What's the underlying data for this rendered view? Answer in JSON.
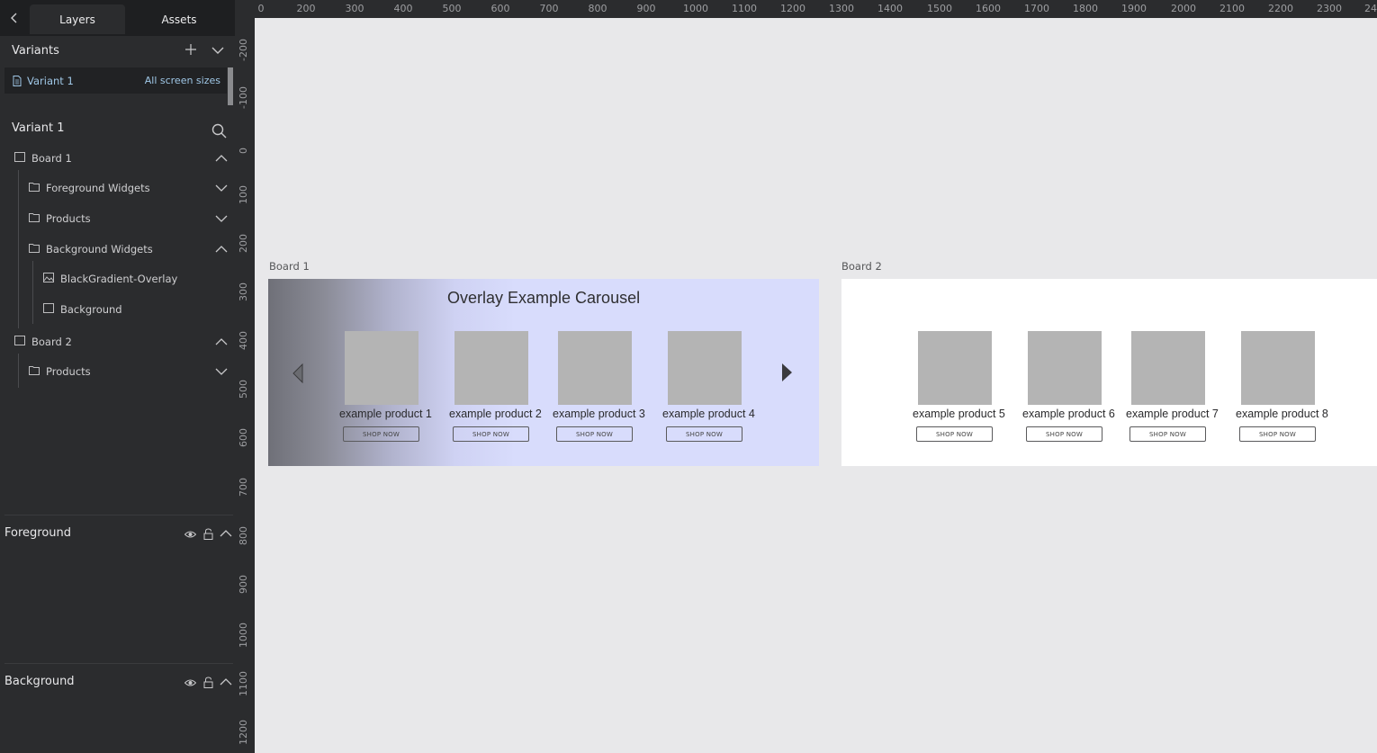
{
  "tabs": {
    "back_icon": "chevron-left-icon",
    "layers": "Layers",
    "assets": "Assets"
  },
  "variants": {
    "title": "Variants",
    "add_icon": "plus-icon",
    "items": [
      {
        "name": "Variant 1",
        "scope": "All screen sizes"
      }
    ]
  },
  "layers": {
    "title": "Variant 1",
    "tree": [
      {
        "label": "Board 1",
        "type": "board",
        "expanded": true
      },
      {
        "label": "Foreground Widgets",
        "type": "folder",
        "expanded": false
      },
      {
        "label": "Products",
        "type": "folder",
        "expanded": false
      },
      {
        "label": "Background Widgets",
        "type": "folder",
        "expanded": true
      },
      {
        "label": "BlackGradient-Overlay",
        "type": "image"
      },
      {
        "label": "Background",
        "type": "rect"
      },
      {
        "label": "Board 2",
        "type": "board",
        "expanded": true
      },
      {
        "label": "Products",
        "type": "folder",
        "expanded": false
      }
    ]
  },
  "sections": {
    "foreground": "Foreground",
    "background": "Background"
  },
  "ruler": {
    "top": [
      "0",
      "200",
      "300",
      "400",
      "500",
      "600",
      "700",
      "800",
      "900",
      "1000",
      "1100",
      "1200",
      "1300",
      "1400",
      "1500",
      "1600",
      "1700",
      "1800",
      "1900",
      "2000",
      "2100",
      "2200",
      "2300",
      "24"
    ],
    "left": [
      "-200",
      "-100",
      "0",
      "100",
      "200",
      "300",
      "400",
      "500",
      "600",
      "700",
      "800",
      "900",
      "1000",
      "1100",
      "1200"
    ]
  },
  "canvas": {
    "board1": {
      "label": "Board 1",
      "title": "Overlay Example Carousel",
      "products": [
        {
          "name": "example product 1",
          "button": "SHOP NOW"
        },
        {
          "name": "example product 2",
          "button": "SHOP NOW"
        },
        {
          "name": "example product 3",
          "button": "SHOP NOW"
        },
        {
          "name": "example product 4",
          "button": "SHOP NOW"
        }
      ]
    },
    "board2": {
      "label": "Board 2",
      "products": [
        {
          "name": "example product 5",
          "button": "SHOP NOW"
        },
        {
          "name": "example product 6",
          "button": "SHOP NOW"
        },
        {
          "name": "example product 7",
          "button": "SHOP NOW"
        },
        {
          "name": "example product 8",
          "button": "SHOP NOW"
        }
      ]
    }
  },
  "colors": {
    "sidebar": "#2b2c2e",
    "canvas": "#e8e8ea",
    "accent_text": "#9fc7e6",
    "overlay_tint": "#d8dcfc",
    "placeholder": "#b4b4b4"
  }
}
